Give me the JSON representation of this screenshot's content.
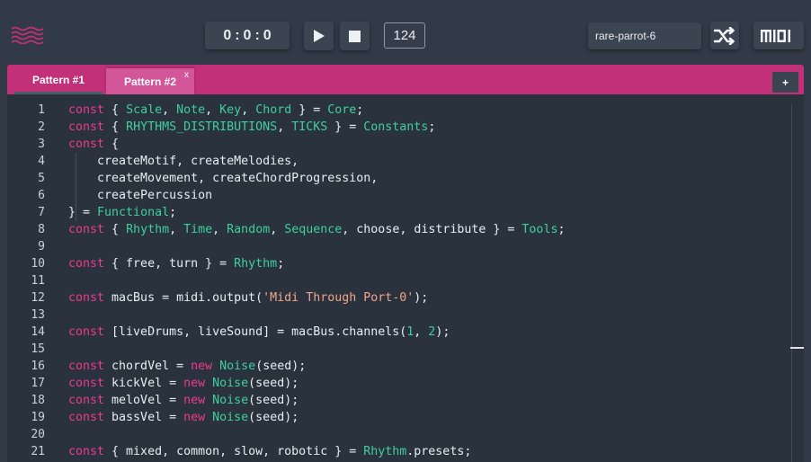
{
  "transport": {
    "time": {
      "bars": "0",
      "beats": "0",
      "ticks": "0",
      "separator": ":"
    },
    "play_label": "play",
    "stop_label": "stop",
    "bpm": "124"
  },
  "seed": {
    "value": "rare-parrot-6"
  },
  "midi_label": "MIDI",
  "tabs": [
    {
      "label": "Pattern #1",
      "active": true
    },
    {
      "label": "Pattern #2",
      "active": false,
      "close": "x"
    }
  ],
  "add_tab_label": "+",
  "editor": {
    "line_numbers": [
      "1",
      "2",
      "3",
      "4",
      "5",
      "6",
      "7",
      "8",
      "9",
      "10",
      "11",
      "12",
      "13",
      "14",
      "15",
      "16",
      "17",
      "18",
      "19",
      "20",
      "21"
    ],
    "lines": [
      [
        [
          "kw",
          "const"
        ],
        [
          "p",
          " { "
        ],
        [
          "ty",
          "Scale"
        ],
        [
          "p",
          ", "
        ],
        [
          "ty",
          "Note"
        ],
        [
          "p",
          ", "
        ],
        [
          "ty",
          "Key"
        ],
        [
          "p",
          ", "
        ],
        [
          "ty",
          "Chord"
        ],
        [
          "p",
          " } = "
        ],
        [
          "ty",
          "Core"
        ],
        [
          "p",
          ";"
        ]
      ],
      [
        [
          "kw",
          "const"
        ],
        [
          "p",
          " { "
        ],
        [
          "ty",
          "RHYTHMS_DISTRIBUTIONS"
        ],
        [
          "p",
          ", "
        ],
        [
          "ty",
          "TICKS"
        ],
        [
          "p",
          " } = "
        ],
        [
          "ty",
          "Constants"
        ],
        [
          "p",
          ";"
        ]
      ],
      [
        [
          "kw",
          "const"
        ],
        [
          "p",
          " {"
        ]
      ],
      [
        [
          "p",
          "    createMotif, createMelodies,"
        ]
      ],
      [
        [
          "p",
          "    createMovement, createChordProgression,"
        ]
      ],
      [
        [
          "p",
          "    createPercussion"
        ]
      ],
      [
        [
          "p",
          "} = "
        ],
        [
          "ty",
          "Functional"
        ],
        [
          "p",
          ";"
        ]
      ],
      [
        [
          "kw",
          "const"
        ],
        [
          "p",
          " { "
        ],
        [
          "ty",
          "Rhythm"
        ],
        [
          "p",
          ", "
        ],
        [
          "ty",
          "Time"
        ],
        [
          "p",
          ", "
        ],
        [
          "ty",
          "Random"
        ],
        [
          "p",
          ", "
        ],
        [
          "ty",
          "Sequence"
        ],
        [
          "p",
          ", choose, distribute } = "
        ],
        [
          "ty",
          "Tools"
        ],
        [
          "p",
          ";"
        ]
      ],
      [],
      [
        [
          "kw",
          "const"
        ],
        [
          "p",
          " { free, turn } = "
        ],
        [
          "ty",
          "Rhythm"
        ],
        [
          "p",
          ";"
        ]
      ],
      [],
      [
        [
          "kw",
          "const"
        ],
        [
          "p",
          " macBus = midi.output("
        ],
        [
          "str",
          "'Midi Through Port-0'"
        ],
        [
          "p",
          ");"
        ]
      ],
      [],
      [
        [
          "kw",
          "const"
        ],
        [
          "p",
          " [liveDrums, liveSound] = macBus.channels("
        ],
        [
          "num",
          "1"
        ],
        [
          "p",
          ", "
        ],
        [
          "num",
          "2"
        ],
        [
          "p",
          ");"
        ]
      ],
      [],
      [
        [
          "kw",
          "const"
        ],
        [
          "p",
          " chordVel = "
        ],
        [
          "kw",
          "new"
        ],
        [
          "p",
          " "
        ],
        [
          "ty",
          "Noise"
        ],
        [
          "p",
          "(seed);"
        ]
      ],
      [
        [
          "kw",
          "const"
        ],
        [
          "p",
          " kickVel = "
        ],
        [
          "kw",
          "new"
        ],
        [
          "p",
          " "
        ],
        [
          "ty",
          "Noise"
        ],
        [
          "p",
          "(seed);"
        ]
      ],
      [
        [
          "kw",
          "const"
        ],
        [
          "p",
          " meloVel = "
        ],
        [
          "kw",
          "new"
        ],
        [
          "p",
          " "
        ],
        [
          "ty",
          "Noise"
        ],
        [
          "p",
          "(seed);"
        ]
      ],
      [
        [
          "kw",
          "const"
        ],
        [
          "p",
          " bassVel = "
        ],
        [
          "kw",
          "new"
        ],
        [
          "p",
          " "
        ],
        [
          "ty",
          "Noise"
        ],
        [
          "p",
          "(seed);"
        ]
      ],
      [],
      [
        [
          "kw",
          "const"
        ],
        [
          "p",
          " { mixed, common, slow, robotic } = "
        ],
        [
          "ty",
          "Rhythm"
        ],
        [
          "p",
          ".presets;"
        ]
      ]
    ]
  },
  "colors": {
    "background": "#313a46",
    "tab_strip": "#c2307a",
    "keyword": "#ef3b89",
    "type": "#3fcf9e",
    "string": "#f2a58c"
  }
}
